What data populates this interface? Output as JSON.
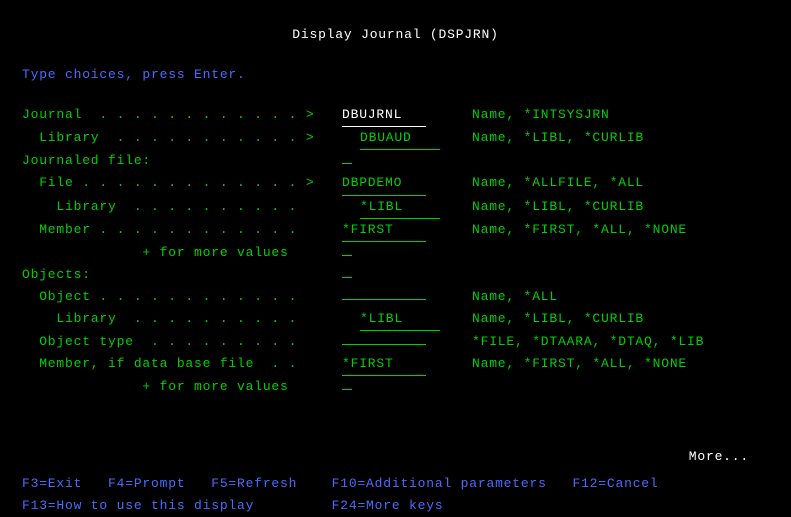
{
  "title": "Display Journal (DSPJRN)",
  "instruction": "Type choices, press Enter.",
  "params": {
    "journal": {
      "prompt": "Journal  . . . . . . . . . . . . >",
      "value": "DBUJRNL",
      "hint": "Name, *INTSYSJRN"
    },
    "journal_lib": {
      "prompt": "  Library  . . . . . . . . . . . >",
      "value": "DBUAUD",
      "hint": "Name, *LIBL, *CURLIB"
    },
    "journaled_file_hdr": {
      "prompt": "Journaled file:"
    },
    "file": {
      "prompt": "  File . . . . . . . . . . . . . >",
      "value": "DBPDEMO",
      "hint": "Name, *ALLFILE, *ALL"
    },
    "file_lib": {
      "prompt": "    Library  . . . . . . . . . .  ",
      "value": "*LIBL",
      "hint": "Name, *LIBL, *CURLIB"
    },
    "member": {
      "prompt": "  Member . . . . . . . . . . . .  ",
      "value": "*FIRST",
      "hint": "Name, *FIRST, *ALL, *NONE"
    },
    "more1": {
      "prompt": "              + for more values   "
    },
    "objects_hdr": {
      "prompt": "Objects:"
    },
    "object": {
      "prompt": "  Object . . . . . . . . . . . .  ",
      "value": "",
      "hint": "Name, *ALL"
    },
    "object_lib": {
      "prompt": "    Library  . . . . . . . . . .  ",
      "value": "*LIBL",
      "hint": "Name, *LIBL, *CURLIB"
    },
    "object_type": {
      "prompt": "  Object type  . . . . . . . . .  ",
      "value": "",
      "hint": "*FILE, *DTAARA, *DTAQ, *LIB"
    },
    "member2": {
      "prompt": "  Member, if data base file  . .  ",
      "value": "*FIRST",
      "hint": "Name, *FIRST, *ALL, *NONE"
    },
    "more2": {
      "prompt": "              + for more values   "
    }
  },
  "more": "More...",
  "fkeys": {
    "line1": "F3=Exit   F4=Prompt   F5=Refresh    F10=Additional parameters   F12=Cancel",
    "line2": "F13=How to use this display         F24=More keys"
  }
}
